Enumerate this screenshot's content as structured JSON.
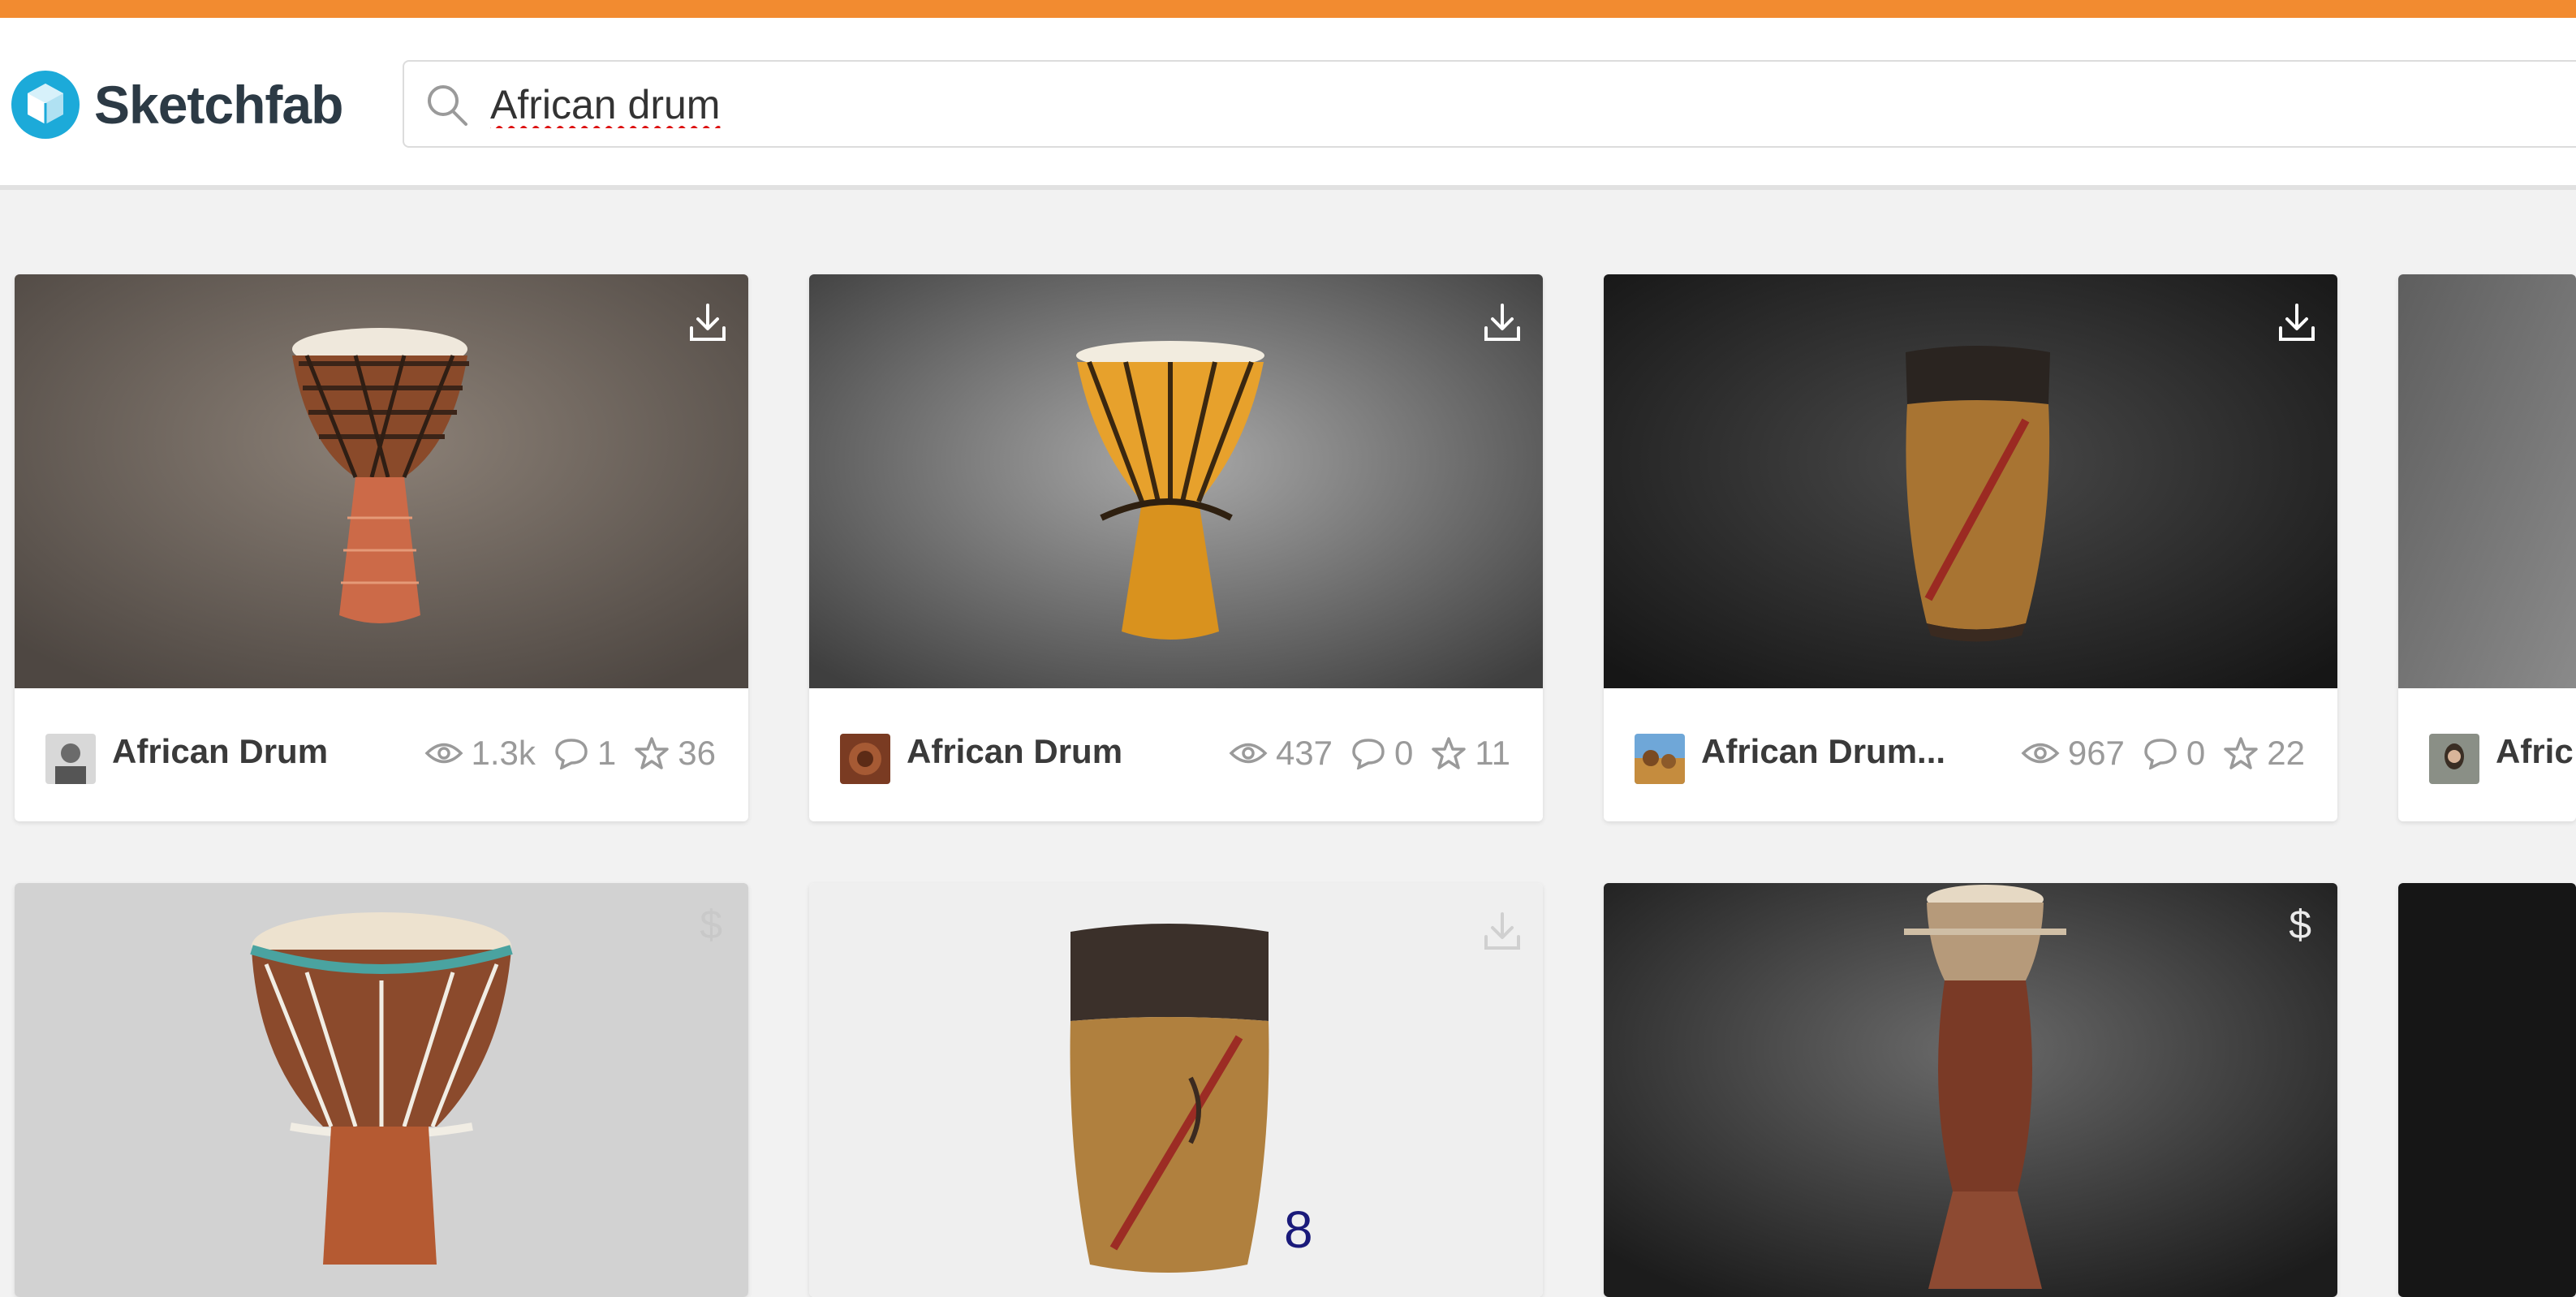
{
  "app": {
    "name": "Sketchfab",
    "accent": "#f28b30",
    "brand": "#1caad9"
  },
  "search": {
    "value": "African drum",
    "icon": "search-icon"
  },
  "results": [
    {
      "title": "African Drum",
      "views": "1.3k",
      "comments": "1",
      "likes": "36",
      "badge": "download-icon"
    },
    {
      "title": "African Drum",
      "views": "437",
      "comments": "0",
      "likes": "11",
      "badge": "download-icon"
    },
    {
      "title": "African Drum...",
      "views": "967",
      "comments": "0",
      "likes": "22",
      "badge": "download-icon"
    },
    {
      "title": "Afric",
      "badge": "none"
    },
    {
      "badge": "$"
    },
    {
      "badge": "download-icon"
    },
    {
      "badge": "$"
    },
    {
      "badge": "none"
    }
  ],
  "page_number": "8"
}
